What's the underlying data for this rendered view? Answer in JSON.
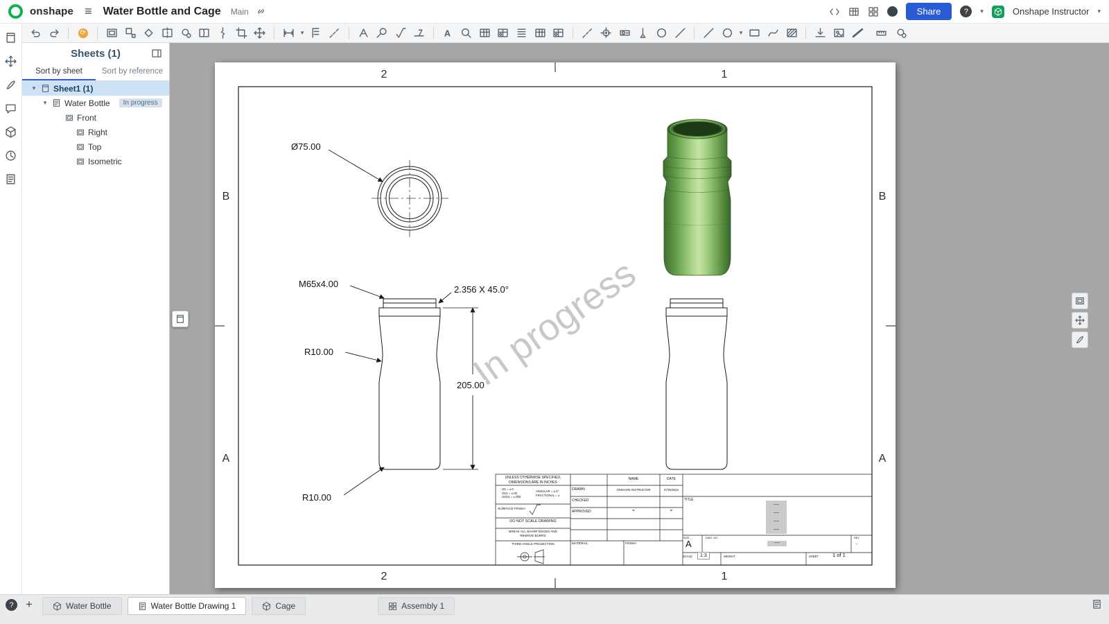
{
  "header": {
    "logo": "onshape",
    "title": "Water Bottle and Cage",
    "workspace": "Main",
    "share": "Share",
    "user": "Onshape Instructor"
  },
  "panel": {
    "title": "Sheets (1)",
    "tab_sheet": "Sort by sheet",
    "tab_reference": "Sort by reference",
    "sheet1": "Sheet1 (1)",
    "item": "Water Bottle",
    "badge": "In progress",
    "views": [
      "Front",
      "Right",
      "Top",
      "Isometric"
    ]
  },
  "sheet": {
    "zone_col_left": "2",
    "zone_col_right": "1",
    "zone_row_top": "B",
    "zone_row_bottom": "A",
    "watermark": "In progress",
    "dims": {
      "diameter": "Ø75.00",
      "thread": "M65x4.00",
      "chamfer": "2.356 X 45.0°",
      "radius_upper": "R10.00",
      "height": "205.00",
      "radius_lower": "R10.00"
    },
    "title_block": {
      "spec": "UNLESS OTHERWISE SPECIFIED,\nDIMENSIONS ARE IN INCHES",
      "tol_linear": ".XX = ±.0\n.XXX = ±.00\n.XXXX = ±.000",
      "tol_angular": "ANGULAR = ±.5°\nFRACTIONAL = ±",
      "surface_finish": "SURFACE FINISH",
      "do_not_scale": "DO NOT SCALE DRAWING",
      "break_edges": "BREAK ALL SHARP EDGES AND\nREMOVE BURRS",
      "third_angle": "THIRD ANGLE PROJECTION",
      "name_header": "NAME",
      "date_header": "DATE",
      "drawn_label": "DRAWN",
      "drawn_name": "ONSHAPE INSTRUCTOR",
      "drawn_date": "07/25/2024",
      "checked_label": "CHECKED",
      "approved_label": "APPROVED",
      "approved_name_mark": "=",
      "approved_date_mark": "=",
      "material_label": "MATERIAL",
      "finish_label": "FINISH",
      "title_label": "TITLE",
      "title_placeholder": "----\n----\n----\n----",
      "size_label": "SIZE",
      "size_value": "A",
      "dwg_label": "DWG. NO.",
      "dwg_value": "----",
      "rev_label": "REV",
      "rev_value": "-",
      "scale_label": "SCALE",
      "scale_value": "1:3",
      "weight_label": "WEIGHT",
      "sheet_label": "SHEET",
      "sheet_value": "1 of 1"
    }
  },
  "tabs": {
    "items": [
      {
        "label": "Water Bottle"
      },
      {
        "label": "Water Bottle Drawing 1"
      },
      {
        "label": "Cage"
      },
      {
        "label": "Assembly 1"
      }
    ]
  },
  "icons": {
    "update": "⟳",
    "help": "?",
    "hamburger": "≡",
    "plus": "+",
    "caret": "▾"
  }
}
